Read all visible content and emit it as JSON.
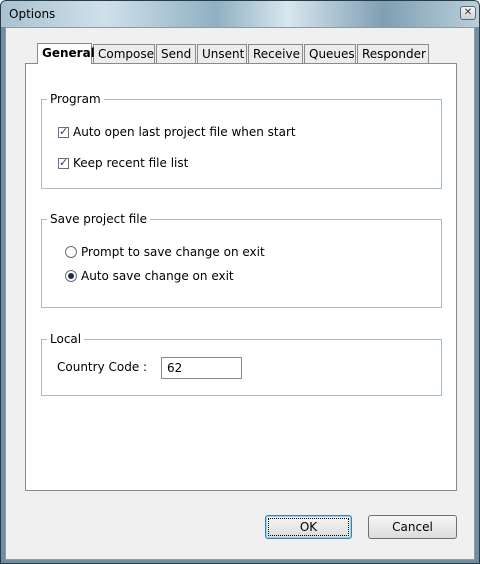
{
  "window": {
    "title": "Options",
    "close_glyph": "✕"
  },
  "tabs": [
    {
      "label": "General",
      "active": true
    },
    {
      "label": "Compose",
      "active": false
    },
    {
      "label": "Send",
      "active": false
    },
    {
      "label": "Unsent",
      "active": false
    },
    {
      "label": "Receive",
      "active": false
    },
    {
      "label": "Queues",
      "active": false
    },
    {
      "label": "Responder",
      "active": false
    }
  ],
  "program": {
    "legend": "Program",
    "auto_open": {
      "label": "Auto open last project file when start",
      "checked": true
    },
    "keep_recent": {
      "label": "Keep recent file list",
      "checked": true
    }
  },
  "save_project": {
    "legend": "Save project file",
    "prompt": {
      "label": "Prompt to save change on exit",
      "selected": false
    },
    "auto_save": {
      "label": "Auto save change on exit",
      "selected": true
    }
  },
  "local": {
    "legend": "Local",
    "country_code_label": "Country Code :",
    "country_code_value": "62"
  },
  "buttons": {
    "ok": "OK",
    "cancel": "Cancel"
  },
  "icons": {
    "checkbox": "checkbox-checked-icon",
    "radio": "radio-icon",
    "close": "close-icon"
  }
}
